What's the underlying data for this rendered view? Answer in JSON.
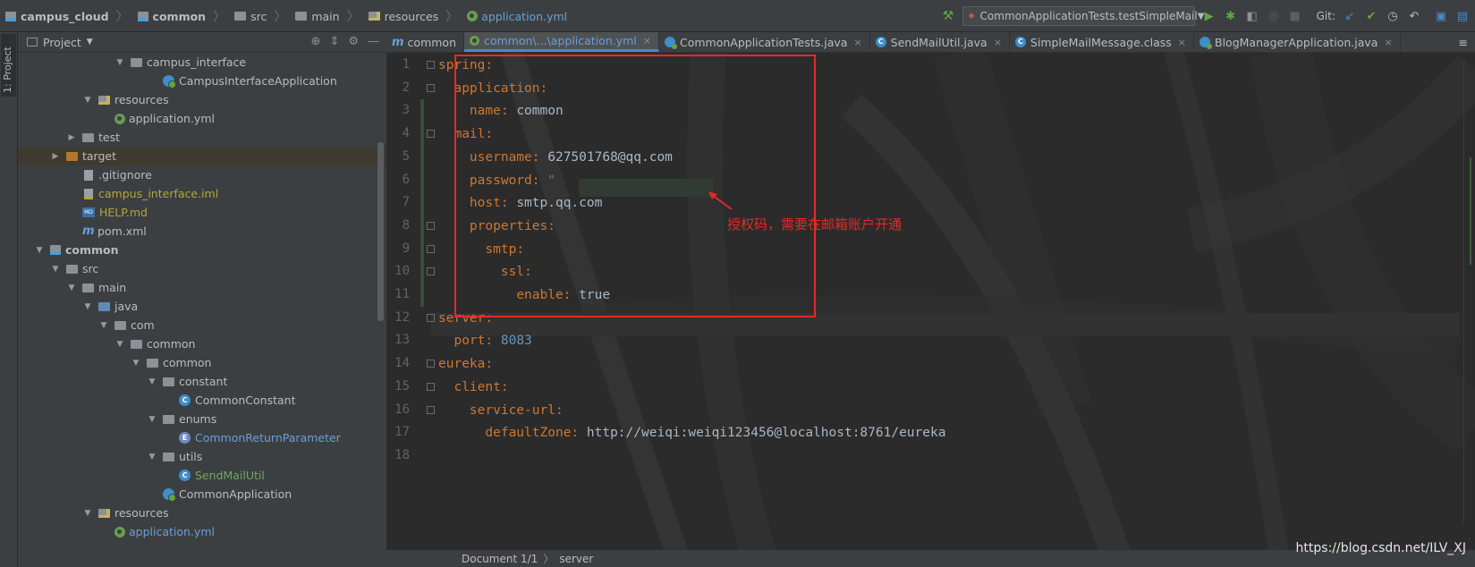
{
  "navbar": {
    "breadcrumbs": [
      "campus_cloud",
      "common",
      "src",
      "main",
      "resources",
      "application.yml"
    ],
    "run_config": "CommonApplicationTests.testSimpleMail",
    "git_label": "Git:"
  },
  "tool_stripe": {
    "label": "1: Project"
  },
  "project_panel": {
    "title": "Project",
    "tree": [
      {
        "label": "campus_interface",
        "indent": 6,
        "arrow": "▼",
        "icon": "folder"
      },
      {
        "label": "CampusInterfaceApplication",
        "indent": 8,
        "arrow": "",
        "icon": "app"
      },
      {
        "label": "resources",
        "indent": 4,
        "arrow": "▼",
        "icon": "folder-res"
      },
      {
        "label": "application.yml",
        "indent": 5,
        "arrow": "",
        "icon": "yml"
      },
      {
        "label": "test",
        "indent": 3,
        "arrow": "▶",
        "icon": "folder"
      },
      {
        "label": "target",
        "indent": 2,
        "arrow": "▶",
        "icon": "folder-orange",
        "highlight": true
      },
      {
        "label": ".gitignore",
        "indent": 3,
        "arrow": "",
        "icon": "file"
      },
      {
        "label": "campus_interface.iml",
        "indent": 3,
        "arrow": "",
        "icon": "iml",
        "color": "olive"
      },
      {
        "label": "HELP.md",
        "indent": 3,
        "arrow": "",
        "icon": "md",
        "color": "olive"
      },
      {
        "label": "pom.xml",
        "indent": 3,
        "arrow": "",
        "icon": "m"
      },
      {
        "label": "common",
        "indent": 1,
        "arrow": "▼",
        "icon": "module",
        "bold": true
      },
      {
        "label": "src",
        "indent": 2,
        "arrow": "▼",
        "icon": "folder"
      },
      {
        "label": "main",
        "indent": 3,
        "arrow": "▼",
        "icon": "folder"
      },
      {
        "label": "java",
        "indent": 4,
        "arrow": "▼",
        "icon": "folder-blue"
      },
      {
        "label": "com",
        "indent": 5,
        "arrow": "▼",
        "icon": "folder"
      },
      {
        "label": "common",
        "indent": 6,
        "arrow": "▼",
        "icon": "folder"
      },
      {
        "label": "common",
        "indent": 7,
        "arrow": "▼",
        "icon": "folder"
      },
      {
        "label": "constant",
        "indent": 8,
        "arrow": "▼",
        "icon": "folder"
      },
      {
        "label": "CommonConstant",
        "indent": 9,
        "arrow": "",
        "icon": "class"
      },
      {
        "label": "enums",
        "indent": 8,
        "arrow": "▼",
        "icon": "folder"
      },
      {
        "label": "CommonReturnParameter",
        "indent": 9,
        "arrow": "",
        "icon": "enum",
        "color": "blue"
      },
      {
        "label": "utils",
        "indent": 8,
        "arrow": "▼",
        "icon": "folder"
      },
      {
        "label": "SendMailUtil",
        "indent": 9,
        "arrow": "",
        "icon": "class",
        "color": "green"
      },
      {
        "label": "CommonApplication",
        "indent": 8,
        "arrow": "",
        "icon": "app"
      },
      {
        "label": "resources",
        "indent": 4,
        "arrow": "▼",
        "icon": "folder-res"
      },
      {
        "label": "application.yml",
        "indent": 5,
        "arrow": "",
        "icon": "yml",
        "color": "blue"
      }
    ]
  },
  "editor": {
    "tabs": [
      {
        "label": "common",
        "icon": "m",
        "active": false
      },
      {
        "label": "common\\...\\application.yml",
        "icon": "yml",
        "active": true,
        "close": true
      },
      {
        "label": "CommonApplicationTests.java",
        "icon": "app",
        "active": false,
        "close": true
      },
      {
        "label": "SendMailUtil.java",
        "icon": "class",
        "active": false,
        "close": true
      },
      {
        "label": "SimpleMailMessage.class",
        "icon": "class",
        "active": false,
        "close": true
      },
      {
        "label": "BlogManagerApplication.java",
        "icon": "app",
        "active": false,
        "close": true
      }
    ],
    "lines": [
      {
        "n": "1",
        "indent": 0,
        "key": "spring",
        "sep": ":",
        "value": "",
        "vtype": ""
      },
      {
        "n": "2",
        "indent": 1,
        "key": "application",
        "sep": ":",
        "value": "",
        "vtype": ""
      },
      {
        "n": "3",
        "indent": 2,
        "key": "name",
        "sep": ": ",
        "value": "common",
        "vtype": "plain"
      },
      {
        "n": "4",
        "indent": 1,
        "key": "mail",
        "sep": ":",
        "value": "",
        "vtype": ""
      },
      {
        "n": "5",
        "indent": 2,
        "key": "username",
        "sep": ": ",
        "value": "627501768@qq.com",
        "vtype": "plain"
      },
      {
        "n": "6",
        "indent": 2,
        "key": "password",
        "sep": ": ",
        "value": "\"",
        "vtype": "str"
      },
      {
        "n": "7",
        "indent": 2,
        "key": "host",
        "sep": ": ",
        "value": "smtp.qq.com",
        "vtype": "plain"
      },
      {
        "n": "8",
        "indent": 2,
        "key": "properties",
        "sep": ":",
        "value": "",
        "vtype": ""
      },
      {
        "n": "9",
        "indent": 3,
        "key": "smtp",
        "sep": ":",
        "value": "",
        "vtype": ""
      },
      {
        "n": "10",
        "indent": 4,
        "key": "ssl",
        "sep": ":",
        "value": "",
        "vtype": ""
      },
      {
        "n": "11",
        "indent": 5,
        "key": "enable",
        "sep": ": ",
        "value": "true",
        "vtype": "plain"
      },
      {
        "n": "12",
        "indent": 0,
        "key": "server",
        "sep": ":",
        "value": "",
        "vtype": ""
      },
      {
        "n": "13",
        "indent": 1,
        "key": "port",
        "sep": ": ",
        "value": "8083",
        "vtype": "num"
      },
      {
        "n": "14",
        "indent": 0,
        "key": "eureka",
        "sep": ":",
        "value": "",
        "vtype": ""
      },
      {
        "n": "15",
        "indent": 1,
        "key": "client",
        "sep": ":",
        "value": "",
        "vtype": ""
      },
      {
        "n": "16",
        "indent": 2,
        "key": "service-url",
        "sep": ":",
        "value": "",
        "vtype": ""
      },
      {
        "n": "17",
        "indent": 3,
        "key": "defaultZone",
        "sep": ": ",
        "value": "http://weiqi:weiqi123456@localhost:8761/eureka",
        "vtype": "plain"
      },
      {
        "n": "18",
        "indent": 0,
        "key": "",
        "sep": "",
        "value": "",
        "vtype": ""
      }
    ],
    "annotation": "授权码，需要在邮箱账户开通",
    "status": {
      "document": "Document 1/1",
      "path": "server"
    }
  },
  "watermark": "https://blog.csdn.net/ILV_XJ",
  "colors": {
    "key": "#cc7832",
    "number": "#6897bb",
    "string": "#6a8759",
    "annotation": "#e52828",
    "accent": "#4a88c7"
  }
}
